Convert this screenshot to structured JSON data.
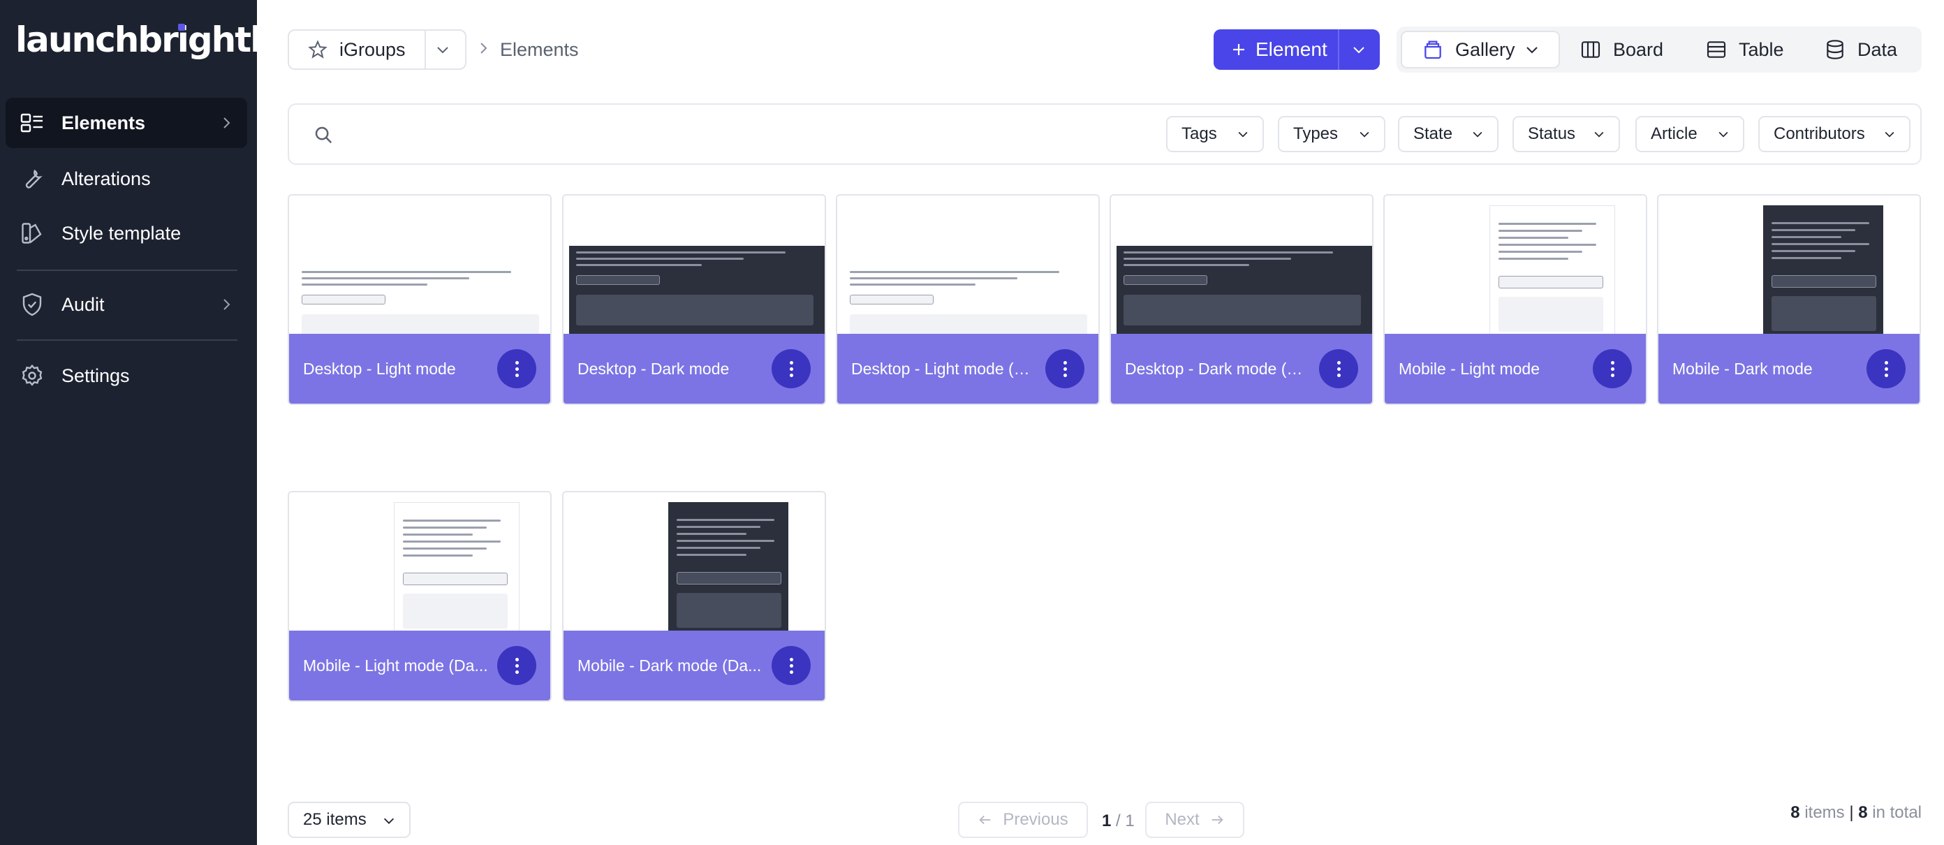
{
  "app": {
    "logo": "launchbrightly"
  },
  "sidebar": {
    "items": [
      {
        "label": "Elements",
        "icon": "elements-icon",
        "active": true,
        "has_chevron": true
      },
      {
        "label": "Alterations",
        "icon": "wrench-icon",
        "active": false,
        "has_chevron": false
      },
      {
        "label": "Style template",
        "icon": "style-template-icon",
        "active": false,
        "has_chevron": false
      },
      {
        "label": "Audit",
        "icon": "shield-check-icon",
        "active": false,
        "has_chevron": true
      },
      {
        "label": "Settings",
        "icon": "gear-icon",
        "active": false,
        "has_chevron": false
      }
    ]
  },
  "header": {
    "group_label": "iGroups",
    "breadcrumb": "Elements",
    "add_button": "Element",
    "views": [
      {
        "label": "Gallery",
        "icon": "gallery-icon",
        "active": true
      },
      {
        "label": "Board",
        "icon": "board-icon",
        "active": false
      },
      {
        "label": "Table",
        "icon": "table-icon",
        "active": false
      },
      {
        "label": "Data",
        "icon": "database-icon",
        "active": false
      }
    ]
  },
  "filters": {
    "search_placeholder": "",
    "items": [
      "Tags",
      "Types",
      "State",
      "Status",
      "Article",
      "Contributors"
    ]
  },
  "gallery": {
    "cards": [
      {
        "title": "Desktop - Light mode",
        "theme": "light",
        "layout": "desktop"
      },
      {
        "title": "Desktop - Dark mode",
        "theme": "dark",
        "layout": "desktop"
      },
      {
        "title": "Desktop - Light mode (Da...",
        "theme": "light",
        "layout": "desktop"
      },
      {
        "title": "Desktop - Dark mode (Da...",
        "theme": "dark",
        "layout": "desktop"
      },
      {
        "title": "Mobile - Light mode",
        "theme": "light",
        "layout": "mobile"
      },
      {
        "title": "Mobile - Dark mode",
        "theme": "dark",
        "layout": "mobile"
      },
      {
        "title": "Mobile - Light mode (Da...",
        "theme": "light",
        "layout": "mobile"
      },
      {
        "title": "Mobile - Dark mode (Da...",
        "theme": "dark",
        "layout": "mobile"
      }
    ]
  },
  "pagination": {
    "per_page": "25 items",
    "previous": "Previous",
    "next": "Next",
    "current": "1",
    "separator": "/",
    "pages": "1",
    "items_count": "8",
    "items_label": "items",
    "total_count": "8",
    "total_label": "in total"
  },
  "colors": {
    "sidebar_bg": "#1d2230",
    "accent": "#4a45e8",
    "card_footer": "#7c74e4",
    "card_menu": "#3b34c0"
  }
}
